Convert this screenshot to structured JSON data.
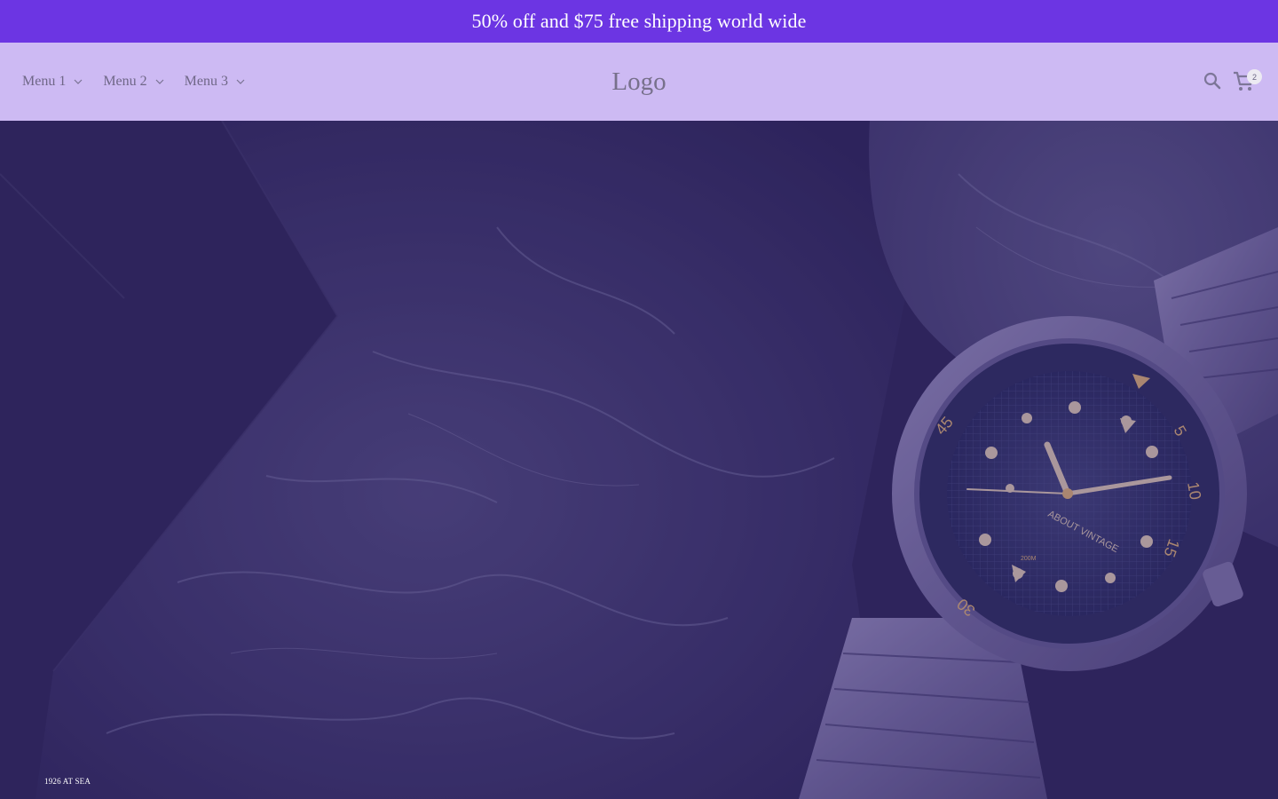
{
  "announcement": {
    "text": "50% off and $75 free shipping world wide"
  },
  "header": {
    "nav": [
      {
        "label": "Menu 1"
      },
      {
        "label": "Menu 2"
      },
      {
        "label": "Menu 3"
      }
    ],
    "logo": "Logo",
    "search_icon": "search-icon",
    "cart_icon": "cart-icon",
    "cart_count": "2"
  },
  "hero": {
    "image": "wristwatch on dark green marble",
    "watch_dial": {
      "brand": "ABOUT VINTAGE",
      "bezel_numbers": [
        "45",
        "5",
        "10",
        "15",
        "30"
      ],
      "depth": "200M"
    },
    "caption": "1926 AT SEA"
  },
  "colors": {
    "announcement_bg": "#6c35e3",
    "header_bg": "#cdbaf3",
    "hero_overlay": "#2b2752"
  }
}
